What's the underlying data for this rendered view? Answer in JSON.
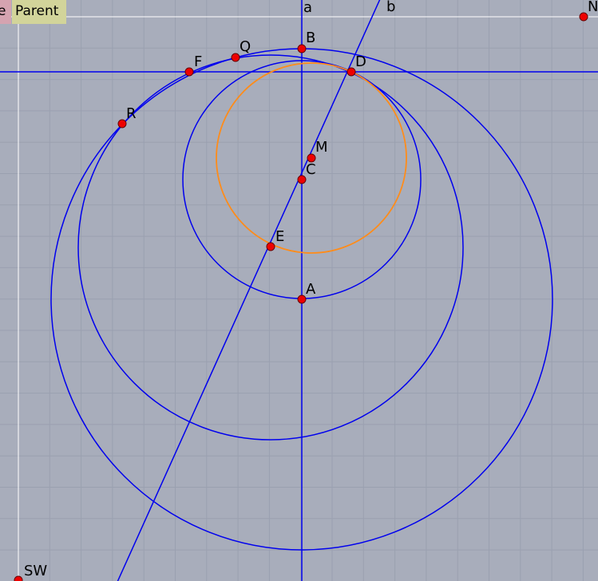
{
  "toolbar": {
    "left_tag": "e",
    "parent_button": "Parent"
  },
  "colors": {
    "background": "#a8adbb",
    "grid": "#9aa0b0",
    "frame": "#ffffff",
    "construction": "#0000ee",
    "highlight_circle": "#ff8c1a",
    "point_fill": "#ee0000"
  },
  "lines": {
    "a": "a",
    "b": "b"
  },
  "points": {
    "A": "A",
    "B": "B",
    "C": "C",
    "D": "D",
    "E": "E",
    "F": "F",
    "M": "M",
    "Q": "Q",
    "R": "R",
    "N": "N",
    "SW": "SW"
  }
}
